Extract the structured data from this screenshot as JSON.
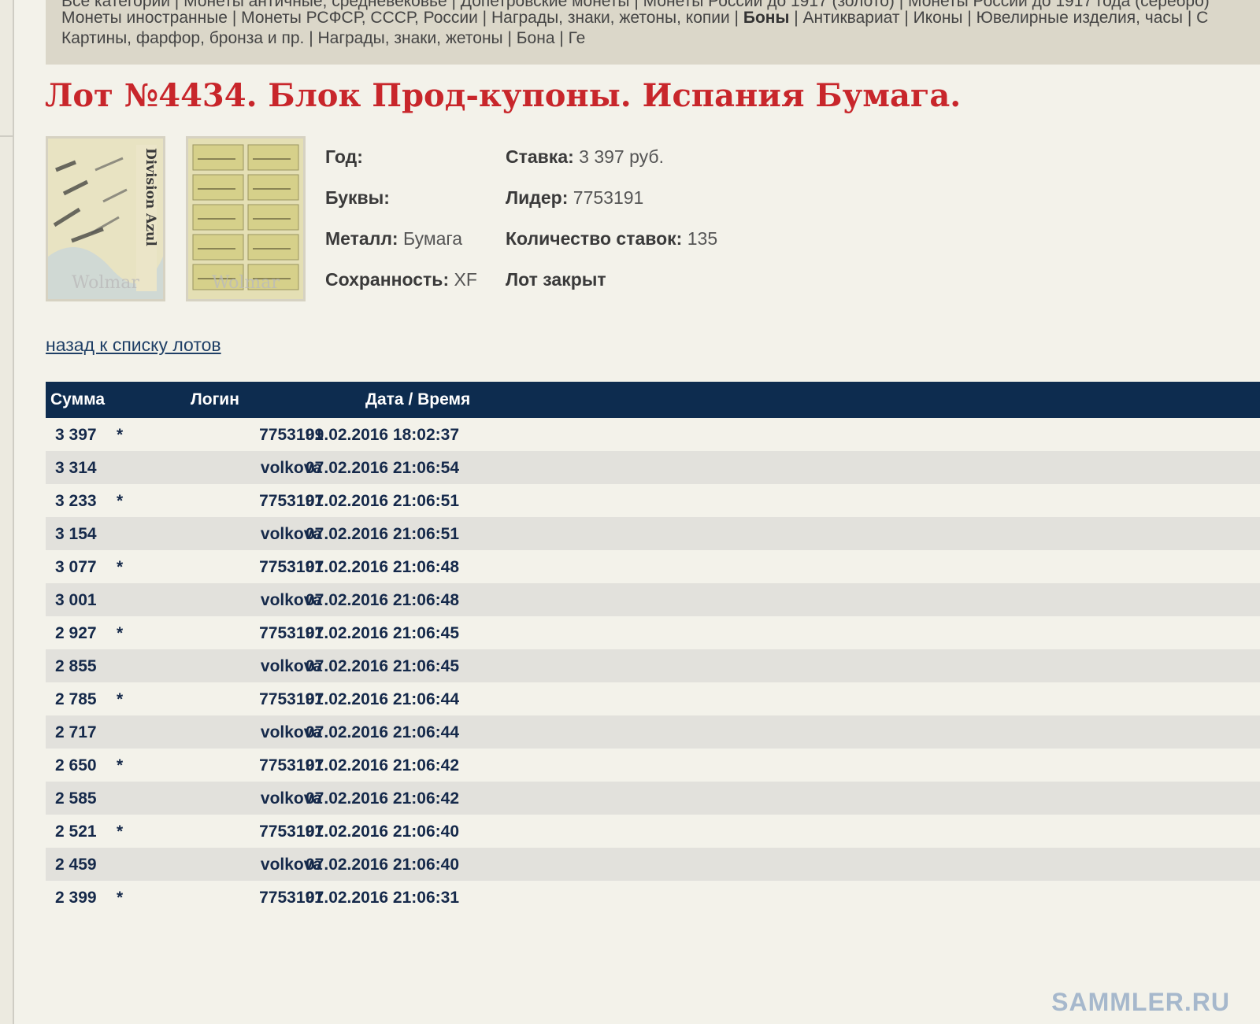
{
  "categories": {
    "line1": "Все категории | Монеты античные, средневековье | Допетровские монеты | Монеты России до 1917 (золото) | Монеты России до 1917 года (серебро)",
    "line2_before": "Монеты иностранные | Монеты РСФСР, СССР, России | Награды, знаки, жетоны, копии | ",
    "line2_bold": "Боны",
    "line2_after": " | Антиквариат | Иконы | Ювелирные изделия, часы | С",
    "line3": "Картины, фарфор, бронза и пр. | Награды, знаки, жетоны | Бона | Ге"
  },
  "lot": {
    "title": "Лот №4434.  Блок Прод-купоны. Испания Бумага.",
    "year_label": "Год:",
    "year_value": "",
    "letters_label": "Буквы:",
    "letters_value": "",
    "metal_label": "Металл:",
    "metal_value": "Бумага",
    "condition_label": "Сохранность:",
    "condition_value": "XF",
    "bid_label": "Ставка:",
    "bid_value": "3 397 руб.",
    "leader_label": "Лидер:",
    "leader_value": "7753191",
    "bids_count_label": "Количество ставок:",
    "bids_count_value": "135",
    "status": "Лот закрыт",
    "thumb1_text": "Division Azul",
    "thumb_watermark": "Wolmar"
  },
  "back_link": "назад к списку лотов",
  "bids_table": {
    "headers": {
      "amount": "Сумма",
      "login": "Логин",
      "datetime": "Дата / Время"
    },
    "rows": [
      {
        "amount": "3 397",
        "star": "*",
        "login": "7753191",
        "datetime": "09.02.2016 18:02:37"
      },
      {
        "amount": "3 314",
        "star": "",
        "login": "volkova",
        "datetime": "07.02.2016 21:06:54"
      },
      {
        "amount": "3 233",
        "star": "*",
        "login": "7753191",
        "datetime": "07.02.2016 21:06:51"
      },
      {
        "amount": "3 154",
        "star": "",
        "login": "volkova",
        "datetime": "07.02.2016 21:06:51"
      },
      {
        "amount": "3 077",
        "star": "*",
        "login": "7753191",
        "datetime": "07.02.2016 21:06:48"
      },
      {
        "amount": "3 001",
        "star": "",
        "login": "volkova",
        "datetime": "07.02.2016 21:06:48"
      },
      {
        "amount": "2 927",
        "star": "*",
        "login": "7753191",
        "datetime": "07.02.2016 21:06:45"
      },
      {
        "amount": "2 855",
        "star": "",
        "login": "volkova",
        "datetime": "07.02.2016 21:06:45"
      },
      {
        "amount": "2 785",
        "star": "*",
        "login": "7753191",
        "datetime": "07.02.2016 21:06:44"
      },
      {
        "amount": "2 717",
        "star": "",
        "login": "volkova",
        "datetime": "07.02.2016 21:06:44"
      },
      {
        "amount": "2 650",
        "star": "*",
        "login": "7753191",
        "datetime": "07.02.2016 21:06:42"
      },
      {
        "amount": "2 585",
        "star": "",
        "login": "volkova",
        "datetime": "07.02.2016 21:06:42"
      },
      {
        "amount": "2 521",
        "star": "*",
        "login": "7753191",
        "datetime": "07.02.2016 21:06:40"
      },
      {
        "amount": "2 459",
        "star": "",
        "login": "volkova",
        "datetime": "07.02.2016 21:06:40"
      },
      {
        "amount": "2 399",
        "star": "*",
        "login": "7753191",
        "datetime": "07.02.2016 21:06:31"
      }
    ]
  },
  "watermark": "SAMMLER.RU",
  "colors": {
    "title": "#c8262b",
    "table_header": "#0d2c4f",
    "row_text": "#15294a",
    "alt_row": "#e2e1dc"
  }
}
